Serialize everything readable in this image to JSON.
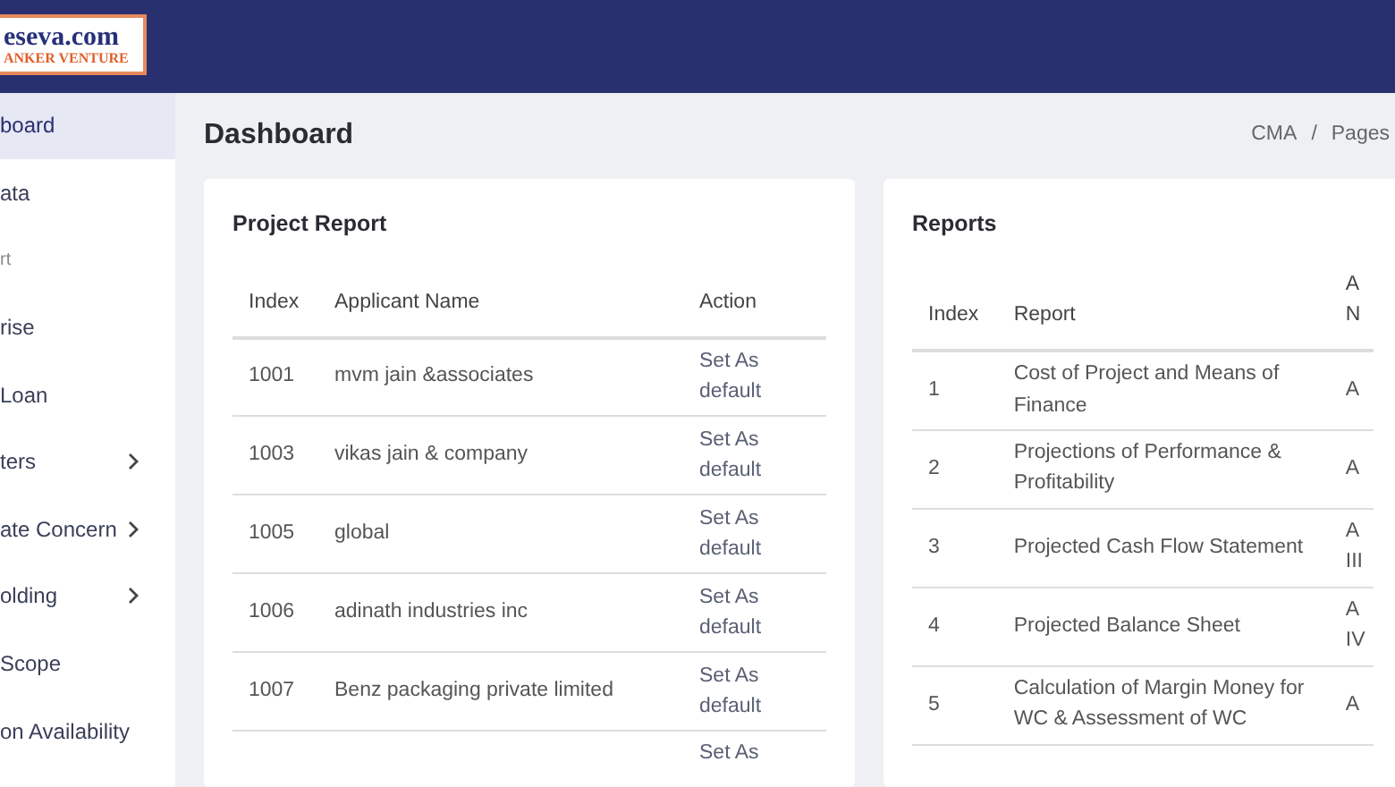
{
  "logo": {
    "line_1": "eseva.com",
    "line_2": "ANKER VENTURE"
  },
  "sidebar": {
    "items": [
      {
        "label": "board",
        "kind": "link",
        "selected": true
      },
      {
        "label": "ata",
        "kind": "link",
        "selected": false
      },
      {
        "label": "rt",
        "kind": "heading",
        "selected": false
      },
      {
        "label": "rise",
        "kind": "link",
        "selected": false
      },
      {
        "label": "Loan",
        "kind": "link",
        "selected": false
      },
      {
        "label": "ters",
        "kind": "submenu",
        "selected": false
      },
      {
        "label": "ate Concern",
        "kind": "submenu",
        "selected": false
      },
      {
        "label": "olding",
        "kind": "submenu",
        "selected": false
      },
      {
        "label": "Scope",
        "kind": "link",
        "selected": false
      },
      {
        "label": "on Availability",
        "kind": "link",
        "selected": false
      }
    ]
  },
  "page_title": "Dashboard",
  "breadcrumb": {
    "items": [
      "CMA",
      "Pages"
    ],
    "separator": "/"
  },
  "project_report": {
    "title": "Project Report",
    "columns": [
      "Index",
      "Applicant Name",
      "Action"
    ],
    "rows": [
      {
        "index": "1001",
        "name": "mvm jain &associates",
        "action": "Set As default"
      },
      {
        "index": "1003",
        "name": "vikas jain & company",
        "action": "Set As default"
      },
      {
        "index": "1005",
        "name": "global",
        "action": "Set As default"
      },
      {
        "index": "1006",
        "name": "adinath industries inc",
        "action": "Set As default"
      },
      {
        "index": "1007",
        "name": "Benz packaging private limited",
        "action": "Set As default"
      },
      {
        "action": "Set As"
      }
    ]
  },
  "reports": {
    "title": "Reports",
    "columns": [
      "Index",
      "Report",
      "A N"
    ],
    "rows": [
      {
        "index": "1",
        "report": "Cost of Project and Means of Finance",
        "column_3": "A"
      },
      {
        "index": "2",
        "report": "Projections of Performance & Profitability",
        "column_3": "A"
      },
      {
        "index": "3",
        "report": "Projected Cash Flow Statement",
        "column_3": "A III"
      },
      {
        "index": "4",
        "report": "Projected Balance Sheet",
        "column_3": "A IV"
      },
      {
        "index": "5",
        "report": "Calculation of Margin Money for WC & Assessment of WC",
        "column_3": "A"
      }
    ]
  }
}
